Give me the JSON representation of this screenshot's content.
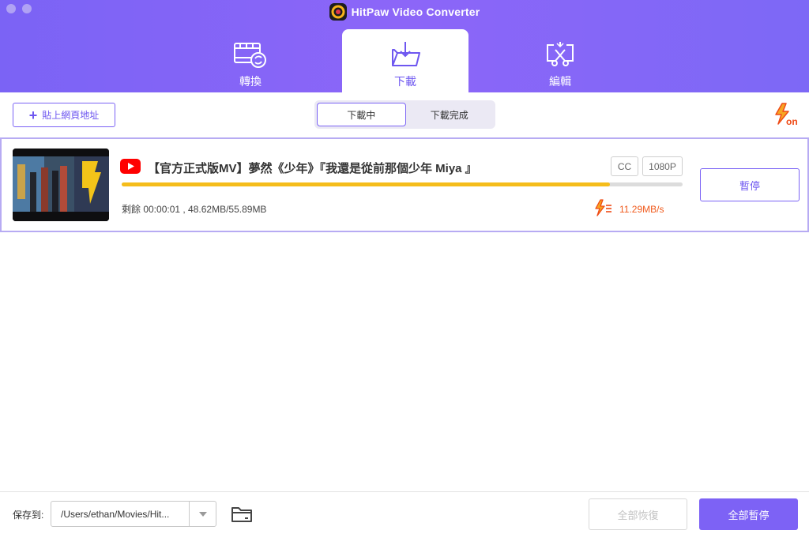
{
  "app": {
    "title": "HitPaw Video Converter"
  },
  "tabs": [
    {
      "label": "轉換",
      "icon": "film-convert-icon"
    },
    {
      "label": "下載",
      "icon": "download-folder-icon",
      "active": true
    },
    {
      "label": "編輯",
      "icon": "scissors-edit-icon"
    }
  ],
  "toolbar": {
    "paste_label": "貼上網頁地址",
    "segments": [
      "下載中",
      "下載完成"
    ],
    "active_segment": "下載中",
    "turbo_icon": "turbo-on-icon"
  },
  "download": {
    "title": "【官方正式版MV】夢然《少年》『我還是從前那個少年 Miya 』",
    "source_icon": "youtube-icon",
    "badges": [
      "CC",
      "1080P"
    ],
    "progress": 0.87,
    "remaining": "剩餘 00:00:01 , 48.62MB/55.89MB",
    "speed": "11.29MB/s",
    "pause_label": "暫停"
  },
  "footer": {
    "save_label": "保存到:",
    "path": "/Users/ethan/Movies/Hit...",
    "resume_all_label": "全部恢復",
    "pause_all_label": "全部暫停"
  },
  "colors": {
    "accent": "#7b63f5",
    "progress": "#f5bd1b",
    "speed": "#f05a1c"
  }
}
